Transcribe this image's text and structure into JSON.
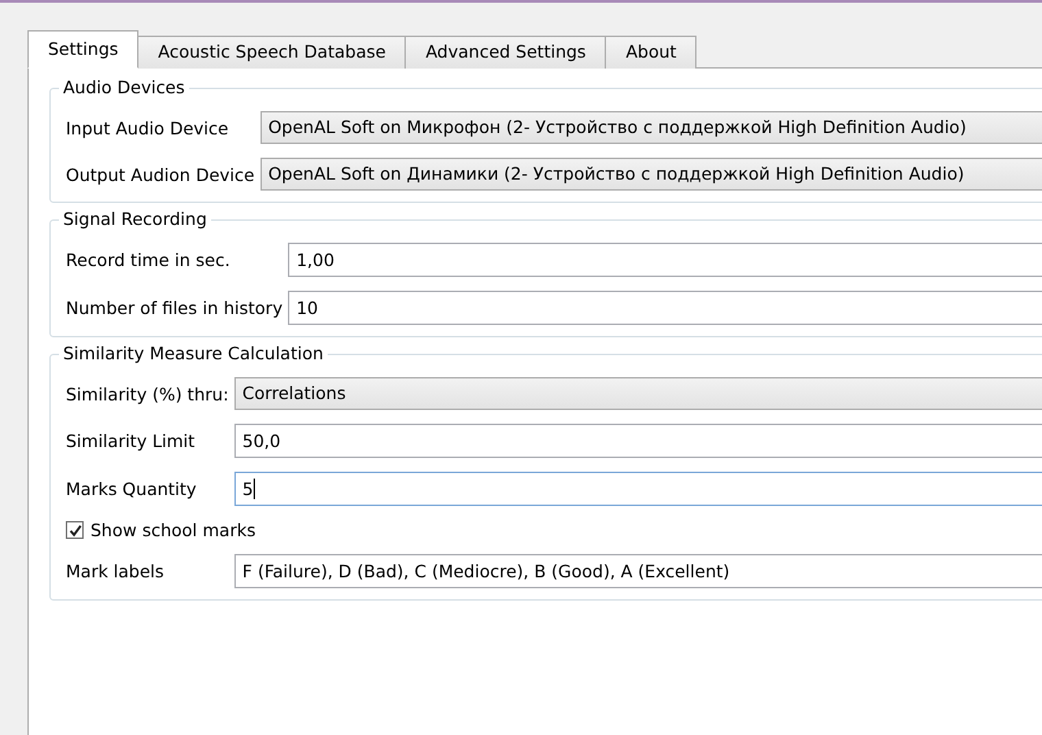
{
  "tabs": [
    {
      "label": "Settings",
      "selected": true
    },
    {
      "label": "Acoustic Speech Database",
      "selected": false
    },
    {
      "label": "Advanced Settings",
      "selected": false
    },
    {
      "label": "About",
      "selected": false
    }
  ],
  "groups": [
    {
      "title": "Audio Devices",
      "rows": [
        {
          "kind": "combo",
          "label": "Input Audio Device",
          "value": "OpenAL Soft on Микрофон (2- Устройство с поддержкой High Definition Audio)"
        },
        {
          "kind": "combo",
          "label": "Output Audion Device",
          "value": "OpenAL Soft on Динамики (2- Устройство с поддержкой High Definition Audio)"
        }
      ]
    },
    {
      "title": "Signal Recording",
      "rows": [
        {
          "kind": "text",
          "label": "Record time in sec.",
          "value": "1,00",
          "focused": false
        },
        {
          "kind": "text",
          "label": "Number of files in history",
          "value": "10",
          "focused": false
        }
      ]
    },
    {
      "title": "Similarity Measure Calculation",
      "rows": [
        {
          "kind": "combo",
          "label": "Similarity (%) thru:",
          "value": "Correlations"
        },
        {
          "kind": "text",
          "label": "Similarity Limit",
          "value": "50,0",
          "focused": false
        },
        {
          "kind": "text",
          "label": "Marks Quantity",
          "value": "5",
          "focused": true
        },
        {
          "kind": "checkbox",
          "label": "Show school marks",
          "checked": true
        },
        {
          "kind": "text",
          "label": "Mark labels",
          "value": "F (Failure), D (Bad), C (Mediocre), B (Good), A (Excellent)",
          "focused": false
        }
      ]
    }
  ]
}
